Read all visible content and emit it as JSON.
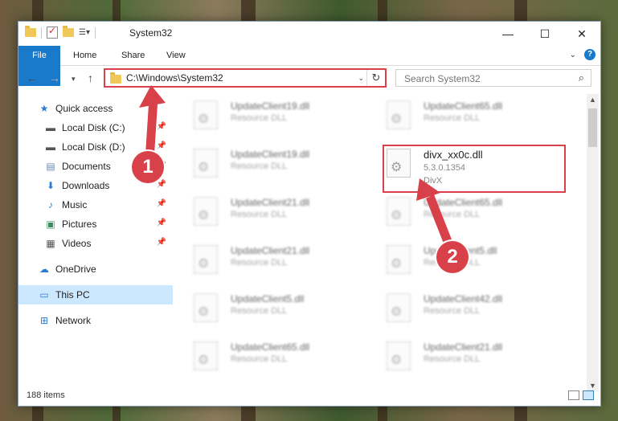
{
  "window": {
    "title": "System32",
    "controls": {
      "minimize": "—",
      "maximize": "☐",
      "close": "✕"
    }
  },
  "ribbon": {
    "tabs": [
      {
        "label": "File"
      },
      {
        "label": "Home"
      },
      {
        "label": "Share"
      },
      {
        "label": "View"
      }
    ]
  },
  "nav": {
    "address": "C:\\Windows\\System32",
    "search_placeholder": "Search System32"
  },
  "sidebar": {
    "items": [
      {
        "label": "Quick access",
        "icon": "star-icon",
        "pinned": false,
        "active": false
      },
      {
        "label": "Local Disk (C:)",
        "icon": "drive-icon",
        "pinned": true,
        "active": false
      },
      {
        "label": "Local Disk (D:)",
        "icon": "drive-icon",
        "pinned": true,
        "active": false
      },
      {
        "label": "Documents",
        "icon": "documents-icon",
        "pinned": true,
        "active": false
      },
      {
        "label": "Downloads",
        "icon": "download-icon",
        "pinned": true,
        "active": false
      },
      {
        "label": "Music",
        "icon": "music-icon",
        "pinned": true,
        "active": false
      },
      {
        "label": "Pictures",
        "icon": "pictures-icon",
        "pinned": true,
        "active": false
      },
      {
        "label": "Videos",
        "icon": "videos-icon",
        "pinned": true,
        "active": false
      },
      {
        "label": "OneDrive",
        "icon": "cloud-icon",
        "pinned": false,
        "active": false
      },
      {
        "label": "This PC",
        "icon": "monitor-icon",
        "pinned": false,
        "active": true
      },
      {
        "label": "Network",
        "icon": "network-icon",
        "pinned": false,
        "active": false
      }
    ]
  },
  "files": [
    {
      "name": "UpdateClient19.dll",
      "type": "Resource DLL"
    },
    {
      "name": "UpdateClient65.dll",
      "type": "Resource DLL"
    },
    {
      "name": "UpdateClient19.dll",
      "type": "Resource DLL"
    },
    {
      "name": "divx_xx0c.dll",
      "type": "5.3.0.1354",
      "company": "DivX"
    },
    {
      "name": "UpdateClient21.dll",
      "type": "Resource DLL"
    },
    {
      "name": "UpdateClient65.dll",
      "type": "Resource DLL"
    },
    {
      "name": "UpdateClient21.dll",
      "type": "Resource DLL"
    },
    {
      "name": "UpdateClient5.dll",
      "type": "Resource DLL"
    },
    {
      "name": "UpdateClient5.dll",
      "type": "Resource DLL"
    },
    {
      "name": "UpdateClient42.dll",
      "type": "Resource DLL"
    },
    {
      "name": "UpdateClient65.dll",
      "type": "Resource DLL"
    },
    {
      "name": "UpdateClient21.dll",
      "type": "Resource DLL"
    }
  ],
  "status": {
    "item_count": "188 items"
  },
  "callouts": [
    {
      "label": "1"
    },
    {
      "label": "2"
    }
  ],
  "colors": {
    "accent": "#1979ca",
    "highlight": "#d9414a",
    "selected": "#cce8ff"
  }
}
